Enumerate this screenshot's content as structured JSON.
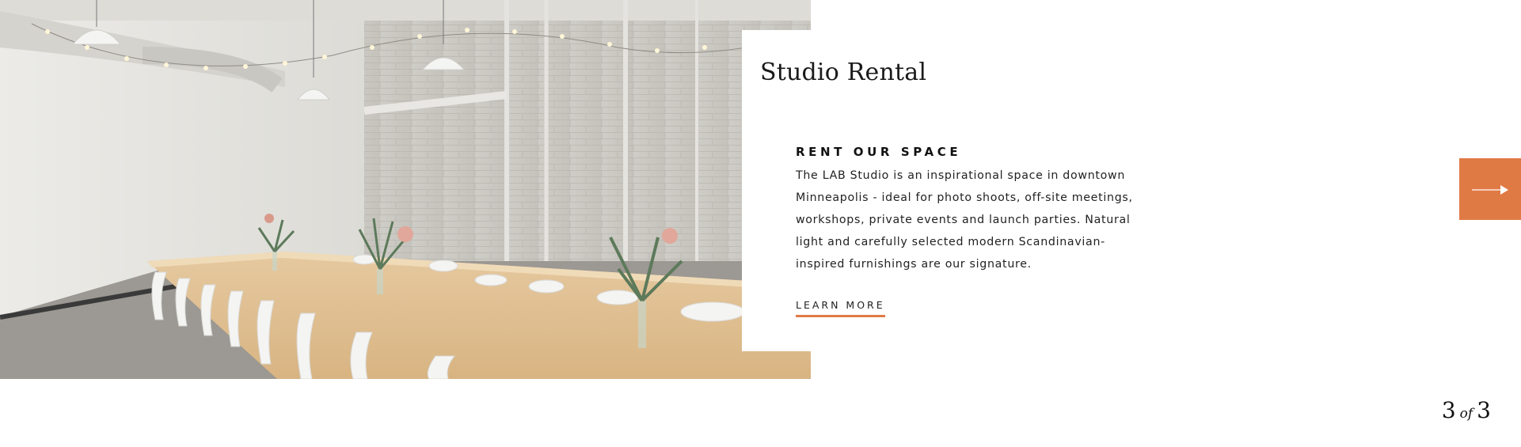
{
  "hero_image": {
    "alt": "Studio interior with long wooden table, white chairs, flowers and string lights"
  },
  "card": {
    "title": "Studio Rental",
    "heading": "RENT OUR SPACE",
    "body": "The LAB Studio is an inspirational space in downtown Minneapolis - ideal for photo shoots, off-site meetings, workshops, private events and launch parties. Natural light and carefully selected modern Scandinavian-inspired furnishings are our signature.",
    "cta_label": "LEARN MORE"
  },
  "navigation": {
    "next_icon": "arrow-right-icon",
    "current": "3",
    "of_label": "of",
    "total": "3"
  },
  "colors": {
    "accent": "#e07a45",
    "text": "#111111",
    "background": "#ffffff"
  }
}
